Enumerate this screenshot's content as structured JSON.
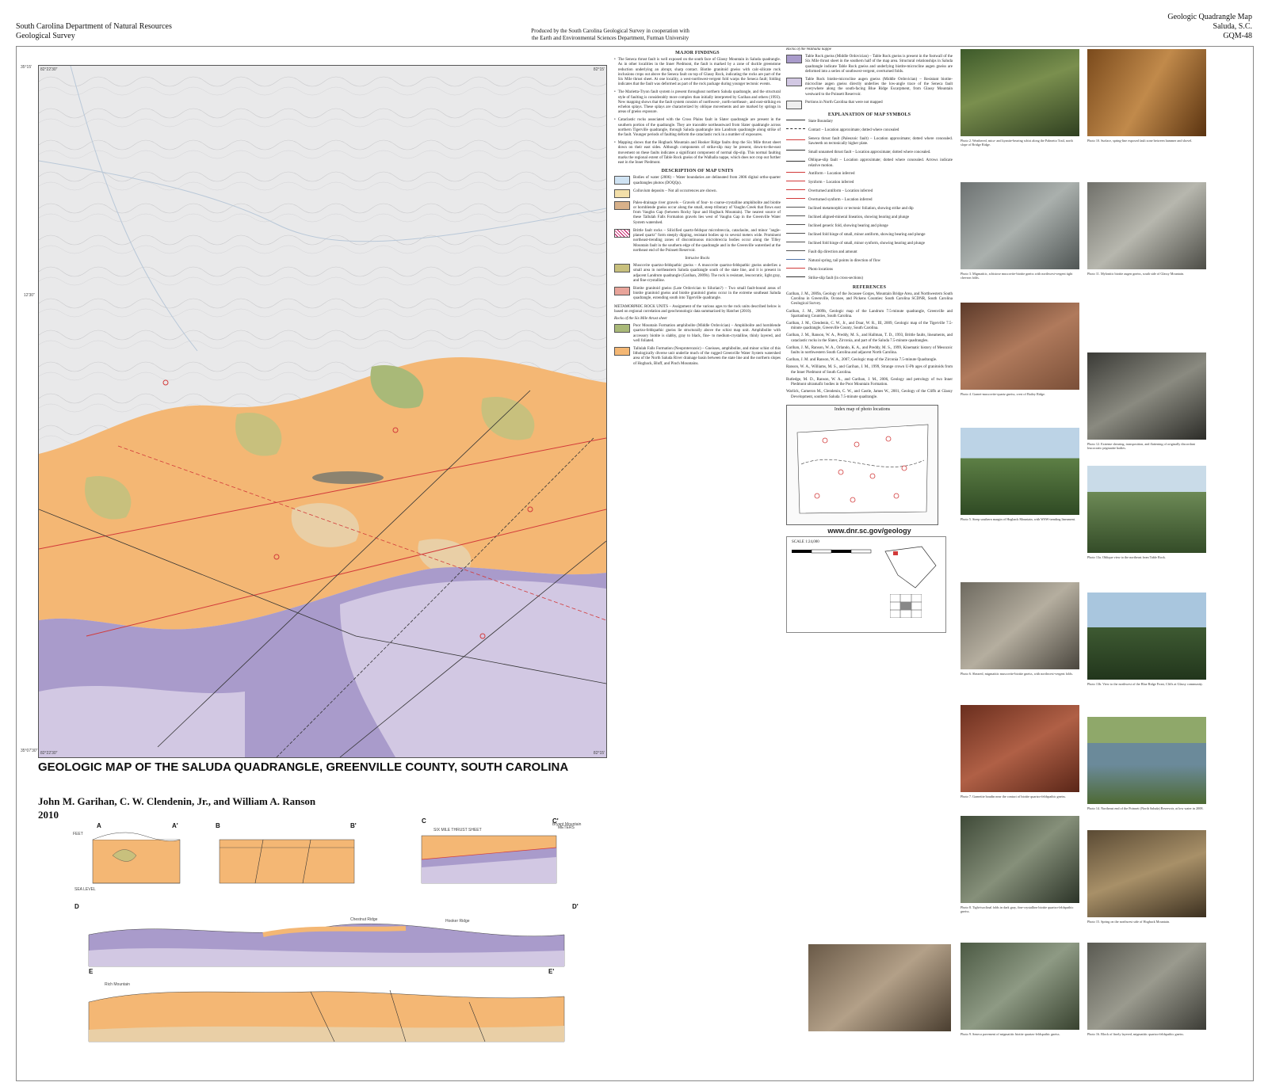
{
  "header": {
    "left_line1": "South Carolina Department of Natural Resources",
    "left_line2": "Geological Survey",
    "center_line1": "Produced by the South Carolina Geological Survey in cooperation with",
    "center_line2": "the Earth and Environmental Sciences Department, Furman University",
    "right_line1": "Geologic Quadrangle Map",
    "right_line2": "Saluda, S.C.",
    "right_line3": "GQM-48"
  },
  "map": {
    "corner_nw": "82°22'30\"",
    "corner_ne": "82°15'",
    "corner_sw": "82°22'30\"",
    "corner_se": "82°15'",
    "lat_top": "35°15'",
    "lat_bottom": "35°07'30\"",
    "lat_mid": "12'30\""
  },
  "title": {
    "main": "GEOLOGIC MAP OF THE SALUDA QUADRANGLE, GREENVILLE COUNTY, SOUTH CAROLINA",
    "authors": "John M. Garihan, C. W. Clendenin, Jr., and William A. Ranson",
    "year": "2010"
  },
  "sections": {
    "a": "A",
    "a2": "A'",
    "b": "B",
    "b2": "B'",
    "c": "C",
    "c2": "C'",
    "d": "D",
    "d2": "D'",
    "e": "E",
    "e2": "E'",
    "feet": "FEET",
    "meters": "METERS",
    "sea_level": "SEA LEVEL",
    "sixmile": "SIX MILE THRUST SHEET",
    "chestnut": "Chestnut Ridge",
    "hooker": "Hooker Ridge",
    "rich": "Rich Mountain",
    "bryant": "Bryant Mountain"
  },
  "text": {
    "major_findings_h": "MAJOR FINDINGS",
    "mf1": "The Seneca thrust fault is well exposed on the south face of Glassy Mountain in Saluda quadrangle. As in other localities in the Inner Piedmont, the fault is marked by a zone of ductile greenstone reduction underlying an abrupt, sharp contact. Biotite granitoid gneiss with calc-silicate rock inclusions crops out above the Seneca fault on top of Glassy Rock, indicating the rocks are part of the Six Mile thrust sheet. At one locality, a west-northwest-vergent fold warps the Seneca fault; folding indicates that the fault was deformed as part of the rock package during younger tectonic events.",
    "mf2": "The Marietta-Tryon fault system is present throughout northern Saluda quadrangle, and the structural style of faulting is considerably more complex than initially interpreted by Garihan and others (1993). New mapping shows that the fault system consists of northwest-, north-northeast-, and east-striking en echelon splays. These splays are characterized by oblique movements and are marked by springs in areas of gneiss exposure.",
    "mf3": "Cataclastic rocks associated with the Cross Plains fault in Slater quadrangle are present in the southern portion of the quadrangle. They are traceable northeastward from Slater quadrangle across northern Tigerville quadrangle, through Saluda quadrangle into Landrum quadrangle along strike of the fault. Younger periods of faulting deform the cataclastic rock in a number of exposures.",
    "mf4": "Mapping shows that the Hogback Mountain and Hooker Ridge faults drop the Six Mile thrust sheet down on their east sides. Although components of strike-slip may be present, down-to-the-east movement on these faults indicates a significant component of normal dip-slip. This normal faulting marks the regional extent of Table Rock gneiss of the Walhalla nappe, which does not crop out further east in the Inner Piedmont.",
    "desc_h": "DESCRIPTION OF MAP UNITS",
    "u_water": "Bodies of water (2006) – Water boundaries are delineated from 2006 digital ortho-quarter quadrangles photos (DOQQs).",
    "u_qc": "Colluvium deposits – Not all occurrences are shown.",
    "u_tg": "Paleo-drainage river gravels – Gravels of four- to coarse-crystalline amphibolite and biotite or hornblende gneiss occur along the small, steep tributary of Vaughn Creek that flows east from Vaughn Gap (between Rocky Spur and Hogback Mountain). The nearest source of these Tallulah Falls Formation gravels lies west of Vaughn Gap in the Greenville Water System watershed.",
    "u_fault": "Brittle fault rocks – Silicified quartz-feldspar microbreccia, cataclasite, and minor \"angle-planed quartz\" form steeply dipping, resistant bodies up to several meters wide. Prominent northeast-trending zones of discontinuous microbreccia bodies occur along the Tilley Mountain fault in the southern edge of the quadrangle and in the Greenville watershed at the northeast end of the Poinsett Reservoir.",
    "intrusive_h": "Intrusive Rocks",
    "u_mqfg": "Muscovite quartzo-feldspathic gneiss – A muscovite quartzo-feldspathic gneiss underlies a small area in northeastern Saluda quadrangle south of the state line, and it is present in adjacent Landrum quadrangle (Garihan, 2009b). The rock is resistant, leucocratic, light gray, and fine-crystalline.",
    "u_bgg": "Biotite granitoid gneiss (Late Ordovician to Silurian?) – Two small fault-bound areas of biotite granitoid gneiss and biotite granitoid gneiss occur in the extreme southeast Saluda quadrangle, extending south into Tigerville quadrangle.",
    "meta_h": "METAMORPHIC ROCK UNITS – Assignment of the various ages to the rock units described below is based on regional correlation and geochronologic data summarized by Hatcher (2010).",
    "sixmile_h": "Rocks of the Six Mile thrust sheet",
    "u_pm": "Poor Mountain Formation amphibolite (Middle Ordovician) – Amphibolite and hornblende quartzo-feldspathic gneiss lie structurally above the schist map unit. Amphibolite with accessory biotite is slabby, gray to black, fine- to medium-crystalline, thinly layered, and well foliated.",
    "u_tf": "Tallulah Falls Formation (Neoproterozoic) – Gneisses, amphibolite, and minor schist of this lithologically diverse unit underlie much of the rugged Greenville Water System watershed area of the North Saluda River drainage basin between the state line and the northern slopes of Hogback, Bluff, and Pinch Mountains.",
    "walhalla_h": "Rocks of the Walhalla nappe",
    "u_trg": "Table Rock gneiss (Middle Ordovician) – Table Rock gneiss is present in the footwall of the Six Mile thrust sheet in the southern half of the map area. Structural relationships in Saluda quadrangle indicate Table Rock gneiss and underlying biotite-microcline augen gneiss are deformed into a series of southwest-vergent, overturned folds.",
    "u_tbag": "Table Rock biotite-microcline augen gneiss (Middle Ordovician) – Resistant biotite-microcline augen gneiss directly underlies the low-angle trace of the Seneca fault everywhere along the south-facing Blue Ridge Escarpment, from Glassy Mountain westward to the Poinsett Reservoir.",
    "nc_note": "Portions in North Carolina that were not mapped",
    "expl_h": "EXPLANATION OF MAP SYMBOLS",
    "sym": [
      "State Boundary",
      "Contact – Location approximate; dotted where concealed",
      "Seneca thrust fault (Paleozoic fault) – Location approximate; dotted where concealed. Sawteeth on tectonically higher plate.",
      "Small unnamed thrust fault – Location approximate; dotted where concealed.",
      "Oblique-slip fault – Location approximate; dotted where concealed. Arrows indicate relative motion.",
      "Antiform – Location inferred",
      "Synform – Location inferred",
      "Overturned antiform – Location inferred",
      "Overturned synform – Location inferred",
      "Inclined metamorphic or tectonic foliation, showing strike and dip",
      "Inclined aligned-mineral lineation, showing bearing and plunge",
      "Inclined generic fold, showing bearing and plunge",
      "Inclined fold hinge of small, minor antiform, showing bearing and plunge",
      "Inclined fold hinge of small, minor synform, showing bearing and plunge",
      "Fault dip direction and amount",
      "Natural spring, tail points in direction of flow",
      "Photo locations",
      "Strike-slip fault (in cross-sections)"
    ],
    "refs_h": "REFERENCES",
    "refs": [
      "Garihan, J. M., 2009a, Geology of the Jocassee Gorges, Mountain Bridge Area, and Northwestern South Carolina in Greenville, Oconee, and Pickens Counties: South Carolina SCDNR, South Carolina Geological Survey.",
      "Garihan, J. M., 2009b, Geologic map of the Landrum 7.5-minute quadrangle, Greenville and Spartanburg Counties, South Carolina.",
      "Garihan, J. M., Clendenin, C. W., Jr., and Doar, W. R., III, 2009, Geologic map of the Tigerville 7.5-minute quadrangle, Greenville County, South Carolina.",
      "Garihan, J. M., Ranson, W. A., Preddy, M. S., and Hallman, T. D., 1993, Brittle faults, lineaments, and cataclastic rocks in the Slater, Zirconia, and part of the Saluda 7.5-minute quadrangles.",
      "Garihan, J. M., Ranson, W. A., Orlando, K. A., and Preddy, M. S., 1999, Kinematic history of Mesozoic faults in northwestern South Carolina and adjacent North Carolina.",
      "Garihan, J. M. and Ranson, W. A., 2007, Geologic map of the Zirconia 7.5-minute Quadrangle.",
      "Ranson, W. A., Williams, M. S., and Garihan, J. M., 1999, Strange crown U-Pb ages of granitoids from the Inner Piedmont of South Carolina.",
      "Rutledge, M. D., Ranson, W. A., and Garihan, J. M., 2006, Geology and petrology of two Inner Piedmont ultramafic bodies in the Poor Mountain Formation.",
      "Warlick, Cameron M., Clendenin, C. W., and Castle, James W., 2001, Geology of the Cliffs at Glassy Development, southern Saluda 7.5-minute quadrangle."
    ],
    "index_title": "Index map of photo locations",
    "url": "www.dnr.sc.gov/geology",
    "scale": "SCALE 1:24,000"
  },
  "photos": {
    "p2": "Photo 2. Weathered, mica- and kyanite-bearing schist along the Palmetto Trail, north slope of Bridge Ridge.",
    "p3": "Photo 3. Migmatitic, schistose muscovite-biotite gneiss with northwest-vergent tight chevron folds.",
    "p4": "Photo 4. Garnet-muscovite-quartz gneiss, crest of Bailey Ridge.",
    "p5": "Photo 5. Steep southern margin of Hogback Mountain, with WSW-trending lineament.",
    "p6": "Photo 6. Sheared, migmatitic muscovite-biotite gneiss, with northwest-vergent folds.",
    "p7": "Photo 7. Garnetite boudin near the contact of biotite quartzo-feldspathic gneiss.",
    "p8": "Photo 8. Tight-isoclinal folds in dark gray, fine-crystalline biotite quartzo-feldspathic gneiss.",
    "p9": "Photo 9. Seneca pavement of migmatitic biotite quartzo-feldspathic gneiss.",
    "p10": "Photo 10. Surface, spring-line exposed fault zone between hammer and shovel.",
    "p11": "Photo 11. Mylonitic biotite augen gneiss, south side of Glassy Mountain.",
    "p12": "Photo 12. Extreme shearing, transposition, and flattening of originally discordant leucocratic pegmatite bodies.",
    "p13a": "Photo 13a. Oblique view to the northeast from Table Rock.",
    "p13b": "Photo 13b. View to the northwest of the Blue Ridge Front, Cliffs at Glassy community.",
    "p14": "Photo 14. Northeast end of the Poinsett (North Saluda) Reservoir, at low water in 2008.",
    "p15": "Photo 15. Spring on the northwest side of Hogback Mountain.",
    "p16": "Photo 16. Block of finely layered, migmatitic quartzo-feldspathic gneiss."
  },
  "colors": {
    "tf_orange": "#f4b774",
    "trg_purple": "#a99bcb",
    "tbag_lilac": "#d2c8e3",
    "pm_olive": "#c8c07d",
    "green_unit": "#a9b978",
    "topo_gray": "#e9e9ea",
    "fault_red": "#d23a3a"
  }
}
